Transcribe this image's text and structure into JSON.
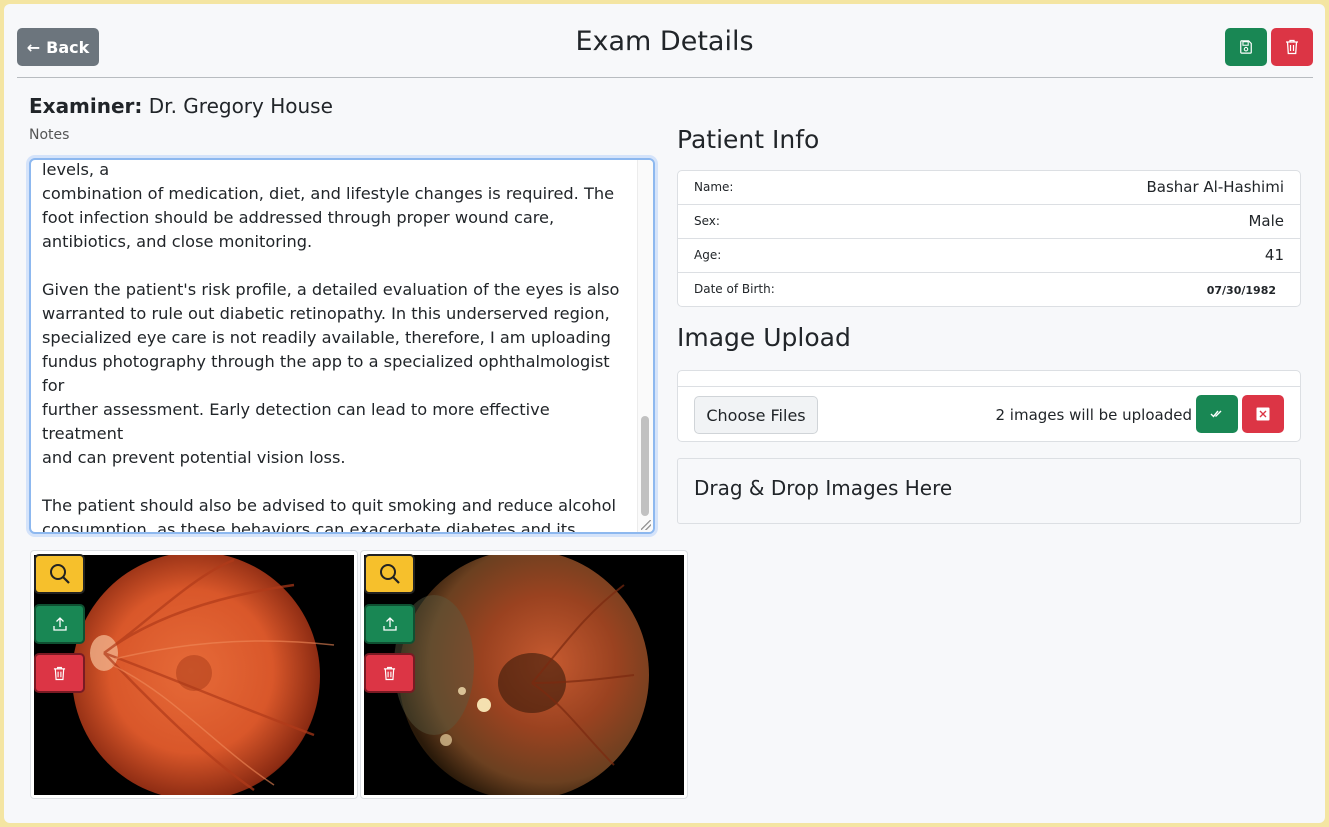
{
  "header": {
    "back_label": "Back",
    "back_arrow": "←",
    "title": "Exam Details",
    "save_icon": "save-icon",
    "delete_icon": "trash-icon"
  },
  "examiner": {
    "label": "Examiner:",
    "name": "Dr. Gregory House"
  },
  "notes": {
    "label": "Notes",
    "text": "treatment. To manage his elevated blood sugar and hemoglobin A1c levels, a\ncombination of medication, diet, and lifestyle changes is required. The\nfoot infection should be addressed through proper wound care,\nantibiotics, and close monitoring.\n\nGiven the patient's risk profile, a detailed evaluation of the eyes is also\nwarranted to rule out diabetic retinopathy. In this underserved region,\nspecialized eye care is not readily available, therefore, I am uploading\nfundus photography through the app to a specialized ophthalmologist for\nfurther assessment. Early detection can lead to more effective treatment\nand can prevent potential vision loss.\n\nThe patient should also be advised to quit smoking and reduce alcohol\nconsumption, as these behaviors can exacerbate diabetes and its\ncomplications. Regular follow-ups will be necessary to monitor his\nprogress and make necessary adjustments to his treatment plan."
  },
  "images": [
    {
      "icons": [
        "magnifier-icon",
        "upload-icon",
        "trash-icon"
      ]
    },
    {
      "icons": [
        "magnifier-icon",
        "upload-icon",
        "trash-icon"
      ]
    }
  ],
  "patient_info": {
    "title": "Patient Info",
    "rows": [
      {
        "key": "Name:",
        "value": "Bashar Al-Hashimi"
      },
      {
        "key": "Sex:",
        "value": "Male"
      },
      {
        "key": "Age:",
        "value": "41"
      },
      {
        "key": "Date of Birth:",
        "value": "07/30/1982"
      }
    ]
  },
  "image_upload": {
    "title": "Image Upload",
    "choose_label": "Choose Files",
    "status": "2 images will be uploaded",
    "drop_label": "Drag & Drop Images Here"
  },
  "colors": {
    "primary_green": "#198754",
    "danger_red": "#dc3545",
    "warning_yellow": "#f6c02c",
    "secondary_gray": "#6c757d"
  }
}
